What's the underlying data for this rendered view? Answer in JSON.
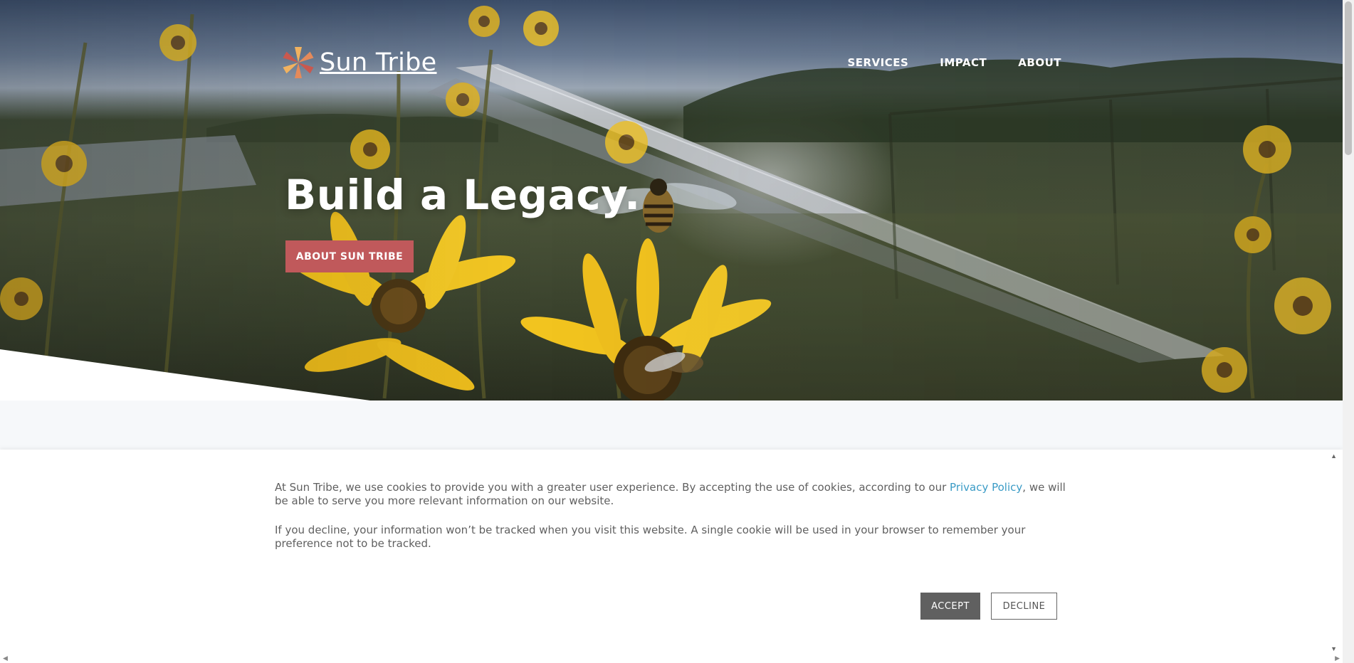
{
  "brand": {
    "name": "Sun Tribe",
    "accent": "#c0595b",
    "logo_colors": [
      "#e58a5a",
      "#c9584e",
      "#f1b25f"
    ]
  },
  "nav": {
    "items": [
      {
        "label": "SERVICES"
      },
      {
        "label": "IMPACT"
      },
      {
        "label": "ABOUT"
      }
    ]
  },
  "hero": {
    "title": "Build a Legacy.",
    "cta_label": "ABOUT SUN TRIBE"
  },
  "cookie_banner": {
    "para1_before": "At Sun Tribe, we use cookies to provide you with a greater user experience. By accepting the use of cookies, according to our ",
    "privacy_link": "Privacy Policy",
    "para1_after": ", we will be able to serve you more relevant information on our website.",
    "para2": "If you decline, your information won’t be tracked when you visit this website. A single cookie will be used in your browser to remember your preference not to be tracked.",
    "accept_label": "ACCEPT",
    "decline_label": "DECLINE",
    "link_color": "#3a9bc6"
  },
  "icons": {
    "banner_up": "triangle-up-icon",
    "banner_down": "triangle-down-icon",
    "scroll_left": "triangle-left-icon",
    "scroll_right": "triangle-right-icon"
  }
}
